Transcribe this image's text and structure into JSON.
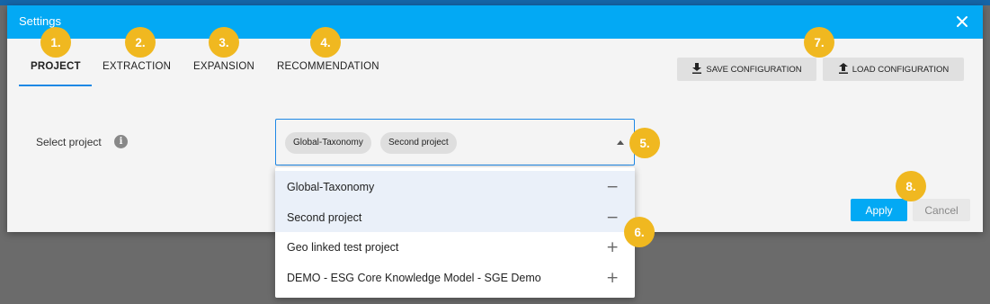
{
  "dialog": {
    "title": "Settings"
  },
  "tabs": [
    {
      "label": "PROJECT",
      "active": true
    },
    {
      "label": "EXTRACTION"
    },
    {
      "label": "EXPANSION"
    },
    {
      "label": "RECOMMENDATION"
    }
  ],
  "toolbar": {
    "save_label": "SAVE CONFIGURATION",
    "load_label": "LOAD CONFIGURATION"
  },
  "project_field": {
    "label": "Select project",
    "selected": [
      "Global-Taxonomy",
      "Second project"
    ]
  },
  "dropdown": {
    "options": [
      {
        "label": "Global-Taxonomy",
        "selected": true,
        "symbol": "−"
      },
      {
        "label": "Second project",
        "selected": true,
        "symbol": "−"
      },
      {
        "label": "Geo linked test project",
        "selected": false,
        "symbol": "+"
      },
      {
        "label": "DEMO - ESG Core Knowledge Model - SGE Demo",
        "selected": false,
        "symbol": "+"
      }
    ]
  },
  "actions": {
    "apply_label": "Apply",
    "cancel_label": "Cancel"
  },
  "annotations": [
    "1.",
    "2.",
    "3.",
    "4.",
    "5.",
    "6.",
    "7.",
    "8."
  ],
  "colors": {
    "title_bar": "#03a9f4",
    "accent": "#1e88e5",
    "badge": "#f0b820",
    "apply_button": "#03a9f4"
  },
  "icons": {
    "close": "close-icon",
    "info": "info-icon",
    "save": "download-icon",
    "load": "upload-icon",
    "caret": "caret-up-icon"
  }
}
